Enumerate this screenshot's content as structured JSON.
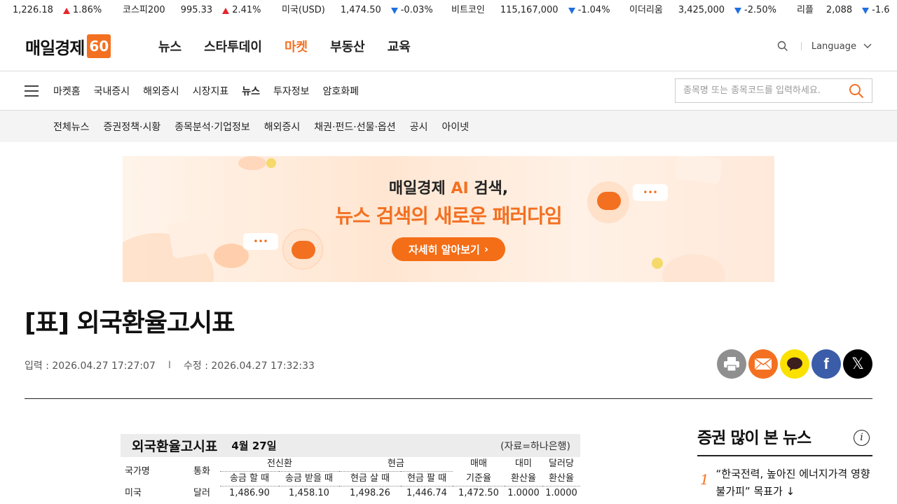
{
  "ticker": [
    {
      "name": "",
      "value": "1,226.18",
      "change": "1.86%",
      "dir": "up"
    },
    {
      "name": "코스피200",
      "value": "995.33",
      "change": "2.41%",
      "dir": "up"
    },
    {
      "name": "미국(USD)",
      "value": "1,474.50",
      "change": "-0.03%",
      "dir": "down"
    },
    {
      "name": "비트코인",
      "value": "115,167,000",
      "change": "-1.04%",
      "dir": "down"
    },
    {
      "name": "이더리움",
      "value": "3,425,000",
      "change": "-2.50%",
      "dir": "down"
    },
    {
      "name": "리플",
      "value": "2,088",
      "change": "-1.6",
      "dir": "down"
    }
  ],
  "header": {
    "logo_text": "매일경제",
    "logo_badge": "60",
    "menu": [
      "뉴스",
      "스타투데이",
      "마켓",
      "부동산",
      "교육"
    ],
    "active_menu": "마켓",
    "language_label": "Language"
  },
  "subnav": {
    "items": [
      "마켓홈",
      "국내증시",
      "해외증시",
      "시장지표",
      "뉴스",
      "투자정보",
      "암호화폐"
    ],
    "active": "뉴스",
    "search_placeholder": "종목명 또는 종목코드를 입력하세요."
  },
  "categories": [
    "전체뉴스",
    "증권정책·시황",
    "종목분석·기업정보",
    "해외증시",
    "채권·펀드·선물·옵션",
    "공시",
    "아이넷"
  ],
  "banner": {
    "line1_prefix": "매일경제 ",
    "line1_ai": "AI",
    "line1_suffix": " 검색,",
    "line2": "뉴스 검색의 새로운 패러다임",
    "button": "자세히 알아보기"
  },
  "article": {
    "title": "[표] 외국환율고시표",
    "input_label": "입력 : 2026.04.27 17:27:07",
    "modified_label": "수정 : 2026.04.27 17:32:33"
  },
  "rate_table": {
    "title": "외국환율고시표",
    "date": "4월 27일",
    "source": "(자료=하나은행)",
    "headers": {
      "country": "국가명",
      "currency": "통화",
      "telegraphic": "전신환",
      "cash": "현금",
      "send": "송금 할 때",
      "receive": "송금 받을 때",
      "buy": "현금 살 때",
      "sell": "현금 팔 때",
      "base_rate": [
        "매매",
        "기준율"
      ],
      "usd_rate": [
        "대미",
        "환산율"
      ],
      "per_usd": [
        "달러당",
        "환산율"
      ]
    },
    "rows": [
      {
        "country": "미국",
        "currency": "달러",
        "send": "1,486.90",
        "receive": "1,458.10",
        "buy": "1,498.26",
        "sell": "1,446.74",
        "base": "1,472.50",
        "usd": "1.0000",
        "per": "1.0000"
      }
    ]
  },
  "sidebar": {
    "title": "증권 많이 본 뉴스",
    "items": [
      {
        "rank": "1",
        "title": "“한국전력, 높아진 에너지가격 영향 불가피” 목표가 ↓"
      }
    ]
  }
}
